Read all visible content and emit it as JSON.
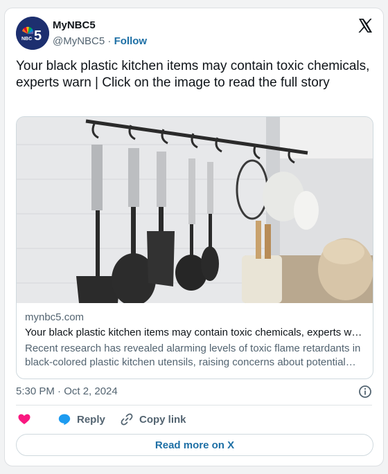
{
  "author": {
    "name": "MyNBC5",
    "handle": "@MyNBC5",
    "separator": "·",
    "follow_label": "Follow",
    "avatar_text": "5",
    "avatar_subtext": "NBC"
  },
  "tweet": {
    "text": "Your black plastic kitchen items may contain toxic chemicals, experts warn | Click on the image to read the full story",
    "timestamp": "5:30 PM · Oct 2, 2024"
  },
  "link_card": {
    "domain": "mynbc5.com",
    "title": "Your black plastic kitchen items may contain toxic chemicals, experts warn",
    "description": "Recent research has revealed alarming levels of toxic flame retardants in black-colored plastic kitchen utensils, raising concerns about potential health risks."
  },
  "actions": {
    "like_icon": "heart-icon",
    "reply_label": "Reply",
    "copy_link_label": "Copy link"
  },
  "read_more_label": "Read more on X",
  "colors": {
    "accent": "#1d6fa5",
    "heart": "#f91880",
    "reply": "#1d9bf0",
    "avatar_bg": "#1d2f6f"
  }
}
